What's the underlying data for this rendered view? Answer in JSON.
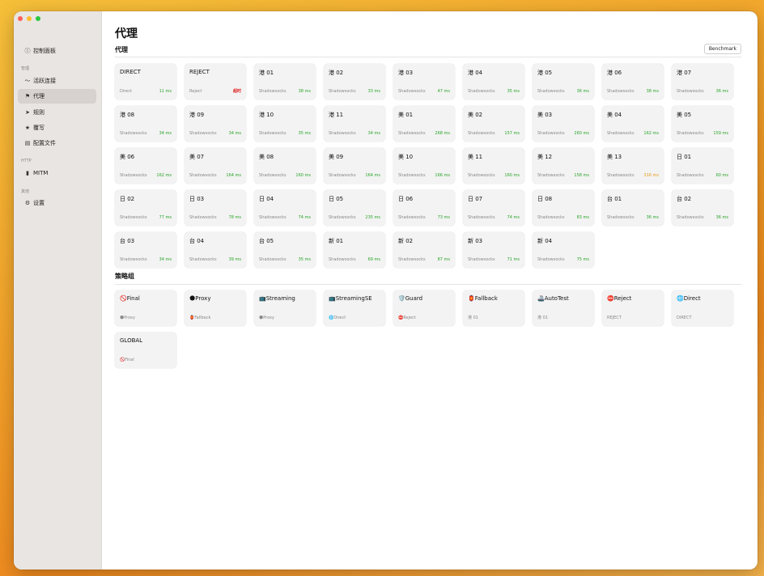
{
  "sidebar": {
    "sections": {
      "manage": "管理",
      "http": "HTTP",
      "other": "其他"
    },
    "items": [
      {
        "label": "控制面板",
        "icon": "info-circle-icon",
        "glyph": "ⓘ"
      },
      {
        "label": "活跃连接",
        "icon": "activity-icon",
        "glyph": "〜"
      },
      {
        "label": "代理",
        "icon": "flag-icon",
        "glyph": "⚑"
      },
      {
        "label": "规则",
        "icon": "location-arrow-icon",
        "glyph": "➤"
      },
      {
        "label": "覆写",
        "icon": "star-icon",
        "glyph": "★"
      },
      {
        "label": "配置文件",
        "icon": "document-icon",
        "glyph": "▤"
      },
      {
        "label": "MITM",
        "icon": "lock-icon",
        "glyph": "🔒"
      },
      {
        "label": "设置",
        "icon": "gear-icon",
        "glyph": "⚙"
      }
    ]
  },
  "page": {
    "title": "代理",
    "proxies_section": "代理",
    "groups_section": "策略组",
    "benchmark_label": "Benchmark"
  },
  "proxies": [
    {
      "name": "DIRECT",
      "type": "Direct",
      "latency": "11 ms",
      "status": "ok"
    },
    {
      "name": "REJECT",
      "type": "Reject",
      "latency": "超时",
      "status": "bad"
    },
    {
      "name": "港 01",
      "type": "Shadowsocks",
      "latency": "38 ms",
      "status": "ok"
    },
    {
      "name": "港 02",
      "type": "Shadowsocks",
      "latency": "33 ms",
      "status": "ok"
    },
    {
      "name": "港 03",
      "type": "Shadowsocks",
      "latency": "47 ms",
      "status": "ok"
    },
    {
      "name": "港 04",
      "type": "Shadowsocks",
      "latency": "35 ms",
      "status": "ok"
    },
    {
      "name": "港 05",
      "type": "Shadowsocks",
      "latency": "36 ms",
      "status": "ok"
    },
    {
      "name": "港 06",
      "type": "Shadowsocks",
      "latency": "38 ms",
      "status": "ok"
    },
    {
      "name": "港 07",
      "type": "Shadowsocks",
      "latency": "36 ms",
      "status": "ok"
    },
    {
      "name": "港 08",
      "type": "Shadowsocks",
      "latency": "34 ms",
      "status": "ok"
    },
    {
      "name": "港 09",
      "type": "Shadowsocks",
      "latency": "34 ms",
      "status": "ok"
    },
    {
      "name": "港 10",
      "type": "Shadowsocks",
      "latency": "35 ms",
      "status": "ok"
    },
    {
      "name": "港 11",
      "type": "Shadowsocks",
      "latency": "34 ms",
      "status": "ok"
    },
    {
      "name": "美 01",
      "type": "Shadowsocks",
      "latency": "268 ms",
      "status": "ok"
    },
    {
      "name": "美 02",
      "type": "Shadowsocks",
      "latency": "157 ms",
      "status": "ok"
    },
    {
      "name": "美 03",
      "type": "Shadowsocks",
      "latency": "260 ms",
      "status": "ok"
    },
    {
      "name": "美 04",
      "type": "Shadowsocks",
      "latency": "162 ms",
      "status": "ok"
    },
    {
      "name": "美 05",
      "type": "Shadowsocks",
      "latency": "159 ms",
      "status": "ok"
    },
    {
      "name": "美 06",
      "type": "Shadowsocks",
      "latency": "162 ms",
      "status": "ok"
    },
    {
      "name": "美 07",
      "type": "Shadowsocks",
      "latency": "164 ms",
      "status": "ok"
    },
    {
      "name": "美 08",
      "type": "Shadowsocks",
      "latency": "160 ms",
      "status": "ok"
    },
    {
      "name": "美 09",
      "type": "Shadowsocks",
      "latency": "164 ms",
      "status": "ok"
    },
    {
      "name": "美 10",
      "type": "Shadowsocks",
      "latency": "166 ms",
      "status": "ok"
    },
    {
      "name": "美 11",
      "type": "Shadowsocks",
      "latency": "160 ms",
      "status": "ok"
    },
    {
      "name": "美 12",
      "type": "Shadowsocks",
      "latency": "158 ms",
      "status": "ok"
    },
    {
      "name": "美 13",
      "type": "Shadowsocks",
      "latency": "316 ms",
      "status": "warn"
    },
    {
      "name": "日 01",
      "type": "Shadowsocks",
      "latency": "60 ms",
      "status": "ok"
    },
    {
      "name": "日 02",
      "type": "Shadowsocks",
      "latency": "77 ms",
      "status": "ok"
    },
    {
      "name": "日 03",
      "type": "Shadowsocks",
      "latency": "78 ms",
      "status": "ok"
    },
    {
      "name": "日 04",
      "type": "Shadowsocks",
      "latency": "74 ms",
      "status": "ok"
    },
    {
      "name": "日 05",
      "type": "Shadowsocks",
      "latency": "235 ms",
      "status": "ok"
    },
    {
      "name": "日 06",
      "type": "Shadowsocks",
      "latency": "73 ms",
      "status": "ok"
    },
    {
      "name": "日 07",
      "type": "Shadowsocks",
      "latency": "74 ms",
      "status": "ok"
    },
    {
      "name": "日 08",
      "type": "Shadowsocks",
      "latency": "83 ms",
      "status": "ok"
    },
    {
      "name": "台 01",
      "type": "Shadowsocks",
      "latency": "36 ms",
      "status": "ok"
    },
    {
      "name": "台 02",
      "type": "Shadowsocks",
      "latency": "36 ms",
      "status": "ok"
    },
    {
      "name": "台 03",
      "type": "Shadowsocks",
      "latency": "34 ms",
      "status": "ok"
    },
    {
      "name": "台 04",
      "type": "Shadowsocks",
      "latency": "39 ms",
      "status": "ok"
    },
    {
      "name": "台 05",
      "type": "Shadowsocks",
      "latency": "35 ms",
      "status": "ok"
    },
    {
      "name": "新 01",
      "type": "Shadowsocks",
      "latency": "69 ms",
      "status": "ok"
    },
    {
      "name": "新 02",
      "type": "Shadowsocks",
      "latency": "87 ms",
      "status": "ok"
    },
    {
      "name": "新 03",
      "type": "Shadowsocks",
      "latency": "71 ms",
      "status": "ok"
    },
    {
      "name": "新 04",
      "type": "Shadowsocks",
      "latency": "75 ms",
      "status": "ok"
    }
  ],
  "groups": [
    {
      "name": "🚫Final",
      "selected": "🌑Proxy"
    },
    {
      "name": "🌑Proxy",
      "selected": "🏮Fallback"
    },
    {
      "name": "📺Streaming",
      "selected": "🌑Proxy"
    },
    {
      "name": "📺StreamingSE",
      "selected": "🌐Direct"
    },
    {
      "name": "🛡️Guard",
      "selected": "⛔Reject"
    },
    {
      "name": "🏮Fallback",
      "selected": "港 01"
    },
    {
      "name": "🚢AutoTest",
      "selected": "港 01"
    },
    {
      "name": "⛔Reject",
      "selected": "REJECT"
    },
    {
      "name": "🌐Direct",
      "selected": "DIRECT"
    },
    {
      "name": "GLOBAL",
      "selected": "🚫Final"
    }
  ],
  "colors": {
    "latency_ok": "#2aa52a",
    "latency_warn": "#e89a1a",
    "latency_bad": "#e02020"
  }
}
